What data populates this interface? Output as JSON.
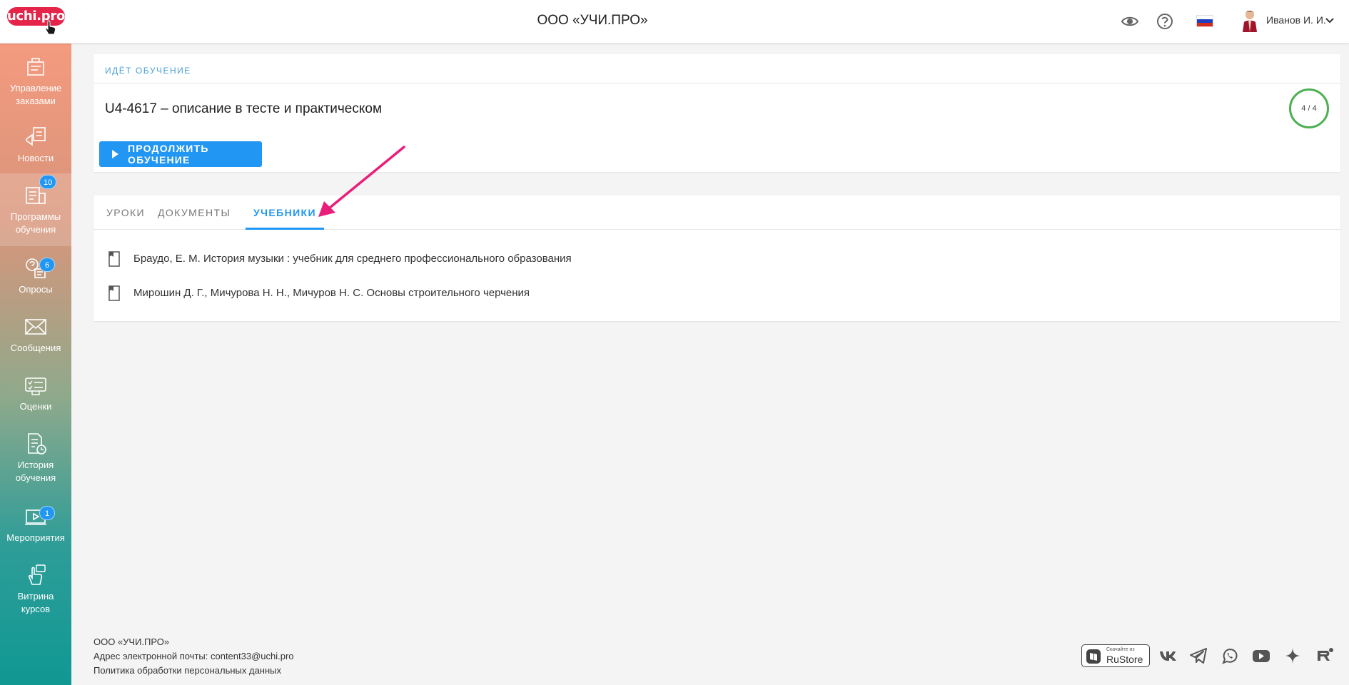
{
  "header": {
    "logo_text": "uchi.pro",
    "org_title": "ООО «УЧИ.ПРО»",
    "icons": [
      "eye-icon",
      "help-icon",
      "russia-flag-icon"
    ],
    "user_name": "Иванов И. И."
  },
  "sidebar": {
    "items": [
      {
        "label_1": "Управление",
        "label_2": "заказами",
        "icon": "orders-icon",
        "badge": ""
      },
      {
        "label_1": "Новости",
        "label_2": "",
        "icon": "news-icon",
        "badge": ""
      },
      {
        "label_1": "Программы",
        "label_2": "обучения",
        "icon": "programs-icon",
        "badge": "10"
      },
      {
        "label_1": "Опросы",
        "label_2": "",
        "icon": "surveys-icon",
        "badge": "6"
      },
      {
        "label_1": "Сообщения",
        "label_2": "",
        "icon": "mail-icon",
        "badge": ""
      },
      {
        "label_1": "Оценки",
        "label_2": "",
        "icon": "grades-icon",
        "badge": ""
      },
      {
        "label_1": "История",
        "label_2": "обучения",
        "icon": "history-icon",
        "badge": ""
      },
      {
        "label_1": "Мероприятия",
        "label_2": "",
        "icon": "events-icon",
        "badge": "1"
      },
      {
        "label_1": "Витрина",
        "label_2": "курсов",
        "icon": "showcase-icon",
        "badge": ""
      }
    ],
    "active_index": 2
  },
  "course": {
    "status": "ИДЁТ ОБУЧЕНИЕ",
    "title": "U4-4617 – описание в тесте и практическом",
    "progress": "4 / 4",
    "continue_label": "ПРОДОЛЖИТЬ ОБУЧЕНИЕ"
  },
  "tabs": {
    "items": [
      "УРОКИ",
      "ДОКУМЕНТЫ",
      "УЧЕБНИКИ"
    ],
    "active": "УЧЕБНИКИ"
  },
  "textbooks": [
    "Браудо, Е. М. История музыки : учебник для среднего профессионального образования",
    "Мирошин Д. Г., Мичурова Н. Н., Мичуров Н. С. Основы строительного черчения"
  ],
  "footer": {
    "org": "ООО «УЧИ.ПРО»",
    "email_line": "Адрес электронной почты: content33@uchi.pro",
    "privacy": "Политика обработки персональных данных",
    "rustore_small": "Скачайте из",
    "rustore_big": "RuStore",
    "social_icons": [
      "vk-icon",
      "telegram-icon",
      "whatsapp-icon",
      "youtube-icon",
      "dzen-icon",
      "rutube-icon"
    ]
  },
  "colors": {
    "accent": "#2196f3",
    "logo": "#e5244a",
    "progress": "#4caf50",
    "annotation_arrow": "#e91e7a"
  }
}
